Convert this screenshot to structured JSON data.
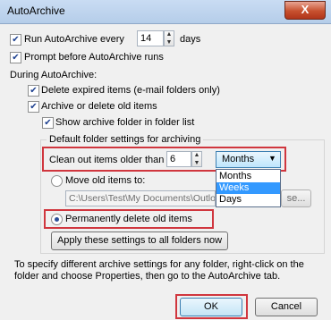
{
  "window": {
    "title": "AutoArchive",
    "close_glyph": "X"
  },
  "run_every": {
    "checked": true,
    "label_before": "Run AutoArchive every",
    "value": "14",
    "label_after": "days"
  },
  "prompt_before": {
    "checked": true,
    "label": "Prompt before AutoArchive runs"
  },
  "during_label": "During AutoArchive:",
  "delete_expired": {
    "checked": true,
    "label": "Delete expired items (e-mail folders only)"
  },
  "archive_old": {
    "checked": true,
    "label": "Archive or delete old items"
  },
  "show_folder": {
    "checked": true,
    "label": "Show archive folder in folder list"
  },
  "defaults_label": "Default folder settings for archiving",
  "clean_out": {
    "label": "Clean out items older than",
    "value": "6",
    "unit_selected": "Months",
    "unit_options": [
      "Months",
      "Weeks",
      "Days"
    ],
    "highlighted_option": "Weeks"
  },
  "move_old": {
    "label": "Move old items to:",
    "path": "C:\\Users\\Test\\My Documents\\Outlo",
    "browse_label": "se..."
  },
  "permanently_delete": {
    "selected": true,
    "label": "Permanently delete old items"
  },
  "apply_button": "Apply these settings to all folders now",
  "help_text": "To specify different archive settings for any folder, right-click on the folder and choose Properties, then go to the AutoArchive tab.",
  "buttons": {
    "ok": "OK",
    "cancel": "Cancel"
  },
  "colors": {
    "highlight_red": "#d0363e",
    "selection_blue": "#3399ff"
  }
}
